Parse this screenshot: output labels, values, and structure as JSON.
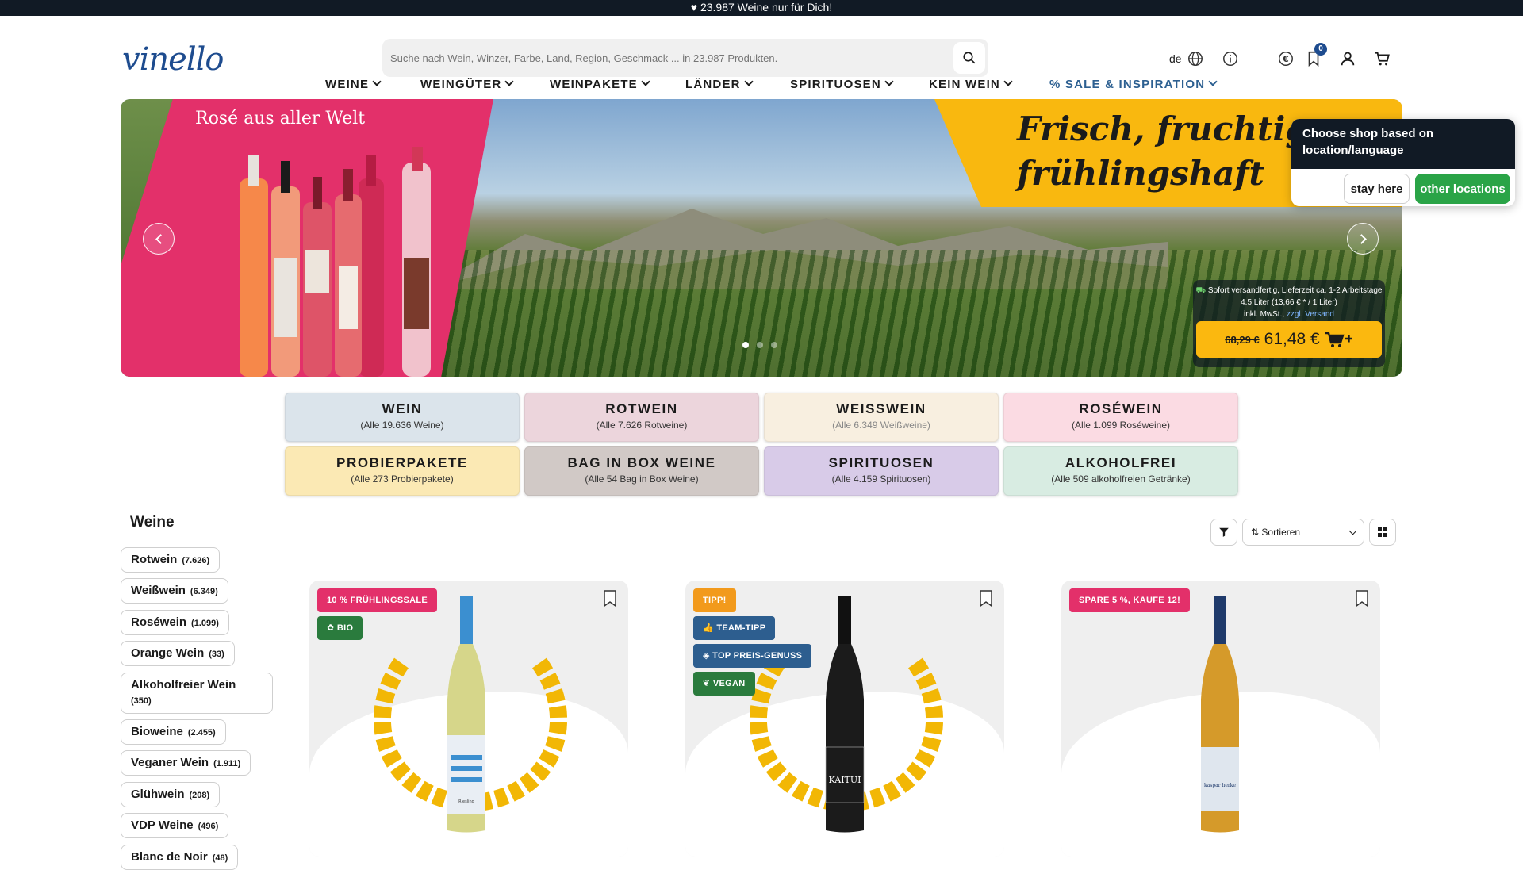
{
  "promo_bar": {
    "text": "♥ 23.987 Weine nur für Dich!"
  },
  "header": {
    "logo_text": "vinello",
    "search_placeholder": "Suche nach Wein, Winzer, Farbe, Land, Region, Geschmack ... in 23.987 Produkten.",
    "language": "de",
    "wishlist_count": "0"
  },
  "nav": [
    {
      "label": "WEINE"
    },
    {
      "label": "WEINGÜTER"
    },
    {
      "label": "WEINPAKETE"
    },
    {
      "label": "LÄNDER"
    },
    {
      "label": "SPIRITUOSEN"
    },
    {
      "label": "KEIN WEIN"
    },
    {
      "label": "% SALE & INSPIRATION"
    }
  ],
  "hero": {
    "title_left": "Rosé aus aller Welt",
    "title_right_line1": "Frisch, fruchtig,",
    "title_right_line2": "frühlingshaft",
    "shipping": "Sofort versandfertig, Lieferzeit ca. 1-2 Arbeitstage",
    "volume": "4.5 Liter (13,66 € * / 1 Liter)",
    "tax": "inkl. MwSt.,",
    "tax_link": "zzgl. Versand",
    "old_price": "68,29 €",
    "new_price": "61,48 €",
    "slide_count": 3,
    "active_slide": 1
  },
  "location_popup": {
    "message": "Choose shop based on location/language",
    "stay": "stay here",
    "other": "other locations"
  },
  "categories": [
    {
      "title": "WEIN",
      "sub": "(Alle 19.636 Weine)",
      "color": "#dbe4eb"
    },
    {
      "title": "ROTWEIN",
      "sub": "(Alle 7.626 Rotweine)",
      "color": "#ecd5dc"
    },
    {
      "title": "WEISSWEIN",
      "sub": "(Alle 6.349 Weißweine)",
      "color": "#f8efe0"
    },
    {
      "title": "ROSÉWEIN",
      "sub": "(Alle 1.099 Roséweine)",
      "color": "#fbdbe3"
    },
    {
      "title": "PROBIERPAKETE",
      "sub": "(Alle 273 Probierpakete)",
      "color": "#fbe9b4"
    },
    {
      "title": "BAG IN BOX WEINE",
      "sub": "(Alle 54 Bag in Box Weine)",
      "color": "#d1c9c6"
    },
    {
      "title": "SPIRITUOSEN",
      "sub": "(Alle 4.159 Spirituosen)",
      "color": "#d8cbe8"
    },
    {
      "title": "ALKOHOLFREI",
      "sub": "(Alle 509 alkoholfreien Getränke)",
      "color": "#d8ece2"
    }
  ],
  "sidebar": {
    "title": "Weine",
    "items": [
      {
        "label": "Rotwein",
        "count": "(7.626)"
      },
      {
        "label": "Weißwein",
        "count": "(6.349)"
      },
      {
        "label": "Roséwein",
        "count": "(1.099)"
      },
      {
        "label": "Orange Wein",
        "count": "(33)"
      },
      {
        "label": "Alkoholfreier Wein",
        "count": "(350)"
      },
      {
        "label": "Bioweine",
        "count": "(2.455)"
      },
      {
        "label": "Veganer Wein",
        "count": "(1.911)"
      },
      {
        "label": "Glühwein",
        "count": "(208)"
      },
      {
        "label": "VDP Weine",
        "count": "(496)"
      },
      {
        "label": "Blanc de Noir",
        "count": "(48)"
      }
    ]
  },
  "toolbar": {
    "sort_label": "Sortieren"
  },
  "products": [
    {
      "badges": [
        "10 % FRÜHLINGSSALE",
        "BIO"
      ],
      "bottle_label": "Riesling"
    },
    {
      "badges": [
        "TIPP!",
        "TEAM-TIPP",
        "TOP PREIS-GENUSS",
        "VEGAN"
      ],
      "bottle_label": "KAITUI"
    },
    {
      "badges": [
        "SPARE 5 %, KAUFE 12!"
      ],
      "bottle_label": "kaspar herke"
    }
  ]
}
